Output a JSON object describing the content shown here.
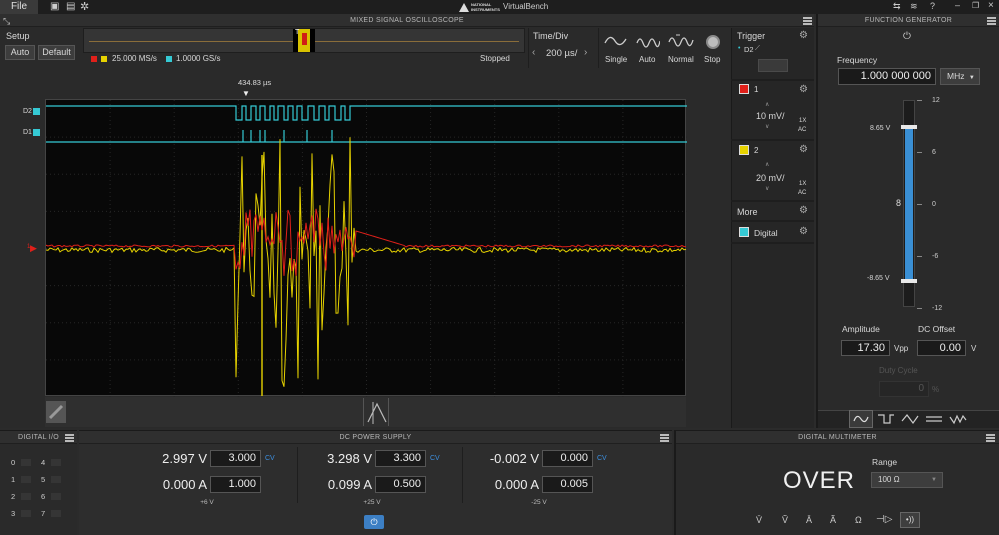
{
  "topbar": {
    "file_label": "File",
    "brand": "NATIONAL INSTRUMENTS",
    "app_title": "VirtualBench",
    "help": "?"
  },
  "scope": {
    "title": "MIXED SIGNAL OSCILLOSCOPE",
    "setup_label": "Setup",
    "auto_label": "Auto",
    "default_label": "Default",
    "rate_analog": "25.000 MS/s",
    "rate_digital": "1.0000 GS/s",
    "status": "Stopped",
    "timediv_label": "Time/Div",
    "timediv_value": "200 µs/",
    "modes": [
      "Single",
      "Auto",
      "Normal",
      "Stop"
    ],
    "cursor_time": "434.83 µs",
    "digital_lines": [
      "D2",
      "D1"
    ],
    "trigger_label": "Trigger",
    "trigger_source": "D2",
    "channels": [
      {
        "num": "1",
        "scale": "10 mV/",
        "probe": "1X",
        "coupling": "AC",
        "color": "#e0201a"
      },
      {
        "num": "2",
        "scale": "20 mV/",
        "probe": "1X",
        "coupling": "AC",
        "color": "#e6d200"
      }
    ],
    "more_label": "More",
    "digital_label": "Digital",
    "colors": {
      "ch1": "#e0201a",
      "ch2": "#e6d200",
      "digital": "#35c9d4"
    }
  },
  "fgen": {
    "title": "FUNCTION GENERATOR",
    "frequency_label": "Frequency",
    "frequency_value": "1.000 000 000",
    "frequency_unit": "MHz",
    "scale_ticks": [
      "12",
      "6",
      "0",
      "-6",
      "-12"
    ],
    "marker_high": "8.65 V",
    "marker_low": "-8.65 V",
    "amplitude_label": "Amplitude",
    "amplitude_value": "17.30",
    "amplitude_unit": "Vpp",
    "offset_label": "DC Offset",
    "offset_value": "0.00",
    "offset_unit": "V",
    "duty_label": "Duty Cycle",
    "duty_value": "0",
    "duty_unit": "%"
  },
  "dio": {
    "title": "DIGITAL I/O",
    "lines": [
      "0",
      "1",
      "2",
      "3",
      "4",
      "5",
      "6",
      "7"
    ]
  },
  "power": {
    "title": "DC POWER SUPPLY",
    "channels": [
      {
        "v_meas": "2.997 V",
        "v_set": "3.000",
        "mode": "CV",
        "i_meas": "0.000 A",
        "i_set": "1.000",
        "label": "+6 V"
      },
      {
        "v_meas": "3.298 V",
        "v_set": "3.300",
        "mode": "CV",
        "i_meas": "0.099 A",
        "i_set": "0.500",
        "label": "+25 V"
      },
      {
        "v_meas": "-0.002 V",
        "v_set": "0.000",
        "mode": "CV",
        "i_meas": "0.000 A",
        "i_set": "0.005",
        "label": "-25 V"
      }
    ]
  },
  "dmm": {
    "title": "DIGITAL MULTIMETER",
    "reading": "OVER",
    "range_label": "Range",
    "range_value": "100 Ω"
  }
}
